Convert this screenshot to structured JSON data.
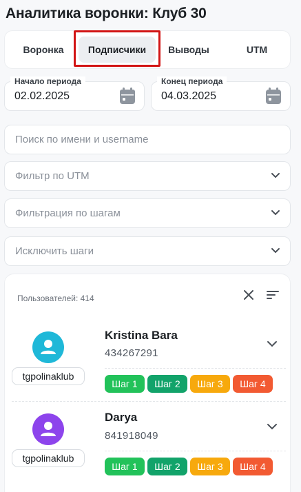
{
  "page": {
    "title": "Аналитика воронки: Клуб 30"
  },
  "tabs": [
    {
      "label": "Воронка",
      "active": false
    },
    {
      "label": "Подписчики",
      "active": true
    },
    {
      "label": "Выводы",
      "active": false
    },
    {
      "label": "UTM",
      "active": false
    }
  ],
  "period": {
    "start_label": "Начало периода",
    "start_value": "02.02.2025",
    "end_label": "Конец периода",
    "end_value": "04.03.2025"
  },
  "filters": {
    "search_placeholder": "Поиск по имени и username",
    "utm_placeholder": "Фильтр по UTM",
    "steps_placeholder": "Фильтрация по шагам",
    "exclude_placeholder": "Исключить шаги"
  },
  "list": {
    "count_label": "Пользователей: 414",
    "users": [
      {
        "name": "Kristina Bara",
        "id": "434267291",
        "source": "tgpolinaklub",
        "avatar_color": "#1fb8d8",
        "steps": [
          "Шаг 1",
          "Шаг 2",
          "Шаг 3",
          "Шаг 4"
        ]
      },
      {
        "name": "Darya",
        "id": "841918049",
        "source": "tgpolinaklub",
        "avatar_color": "#8d44ec",
        "steps": [
          "Шаг 1",
          "Шаг 2",
          "Шаг 3",
          "Шаг 4"
        ]
      }
    ]
  },
  "colors": {
    "step1": "#22c25a",
    "step2": "#12a36a",
    "step3": "#f7a90d",
    "step4": "#f25a32",
    "highlight": "#d21414"
  }
}
